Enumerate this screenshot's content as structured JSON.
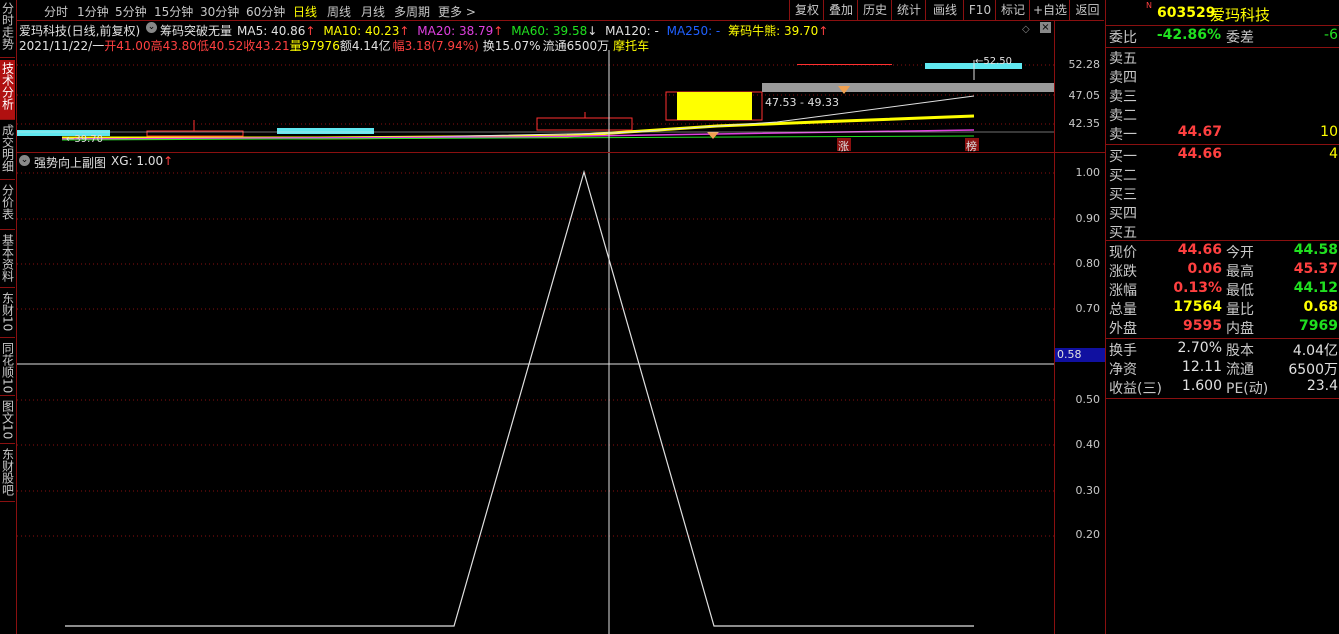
{
  "left_tabs": [
    {
      "label": "分时走势",
      "active": false
    },
    {
      "label": "技术分析",
      "active": true
    },
    {
      "label": "成交明细",
      "active": false
    },
    {
      "label": "分价表",
      "active": false
    },
    {
      "label": "基本资料",
      "active": false
    },
    {
      "label": "东财10",
      "active": false
    },
    {
      "label": "同花顺10",
      "active": false
    },
    {
      "label": "图文10",
      "active": false
    },
    {
      "label": "东财股吧",
      "active": false
    }
  ],
  "toolbar": {
    "periods": [
      "分时",
      "1分钟",
      "5分钟",
      "15分钟",
      "30分钟",
      "60分钟",
      "日线",
      "周线",
      "月线",
      "多周期",
      "更多 >"
    ],
    "selected": "日线",
    "right_buttons": [
      "复权",
      "叠加",
      "历史",
      "统计",
      "画线",
      "F10",
      "标记",
      "+自选",
      "返回"
    ]
  },
  "main_chart": {
    "title": "爱玛科技(日线,前复权)",
    "indicator_name": "筹码突破无量",
    "ma": [
      {
        "label": "MA5: 40.86",
        "arrow": "↑",
        "color": "#e0e0e0"
      },
      {
        "label": "MA10: 40.23",
        "arrow": "↑",
        "color": "#ffff00"
      },
      {
        "label": "MA20: 38.79",
        "arrow": "↑",
        "color": "#e040e0"
      },
      {
        "label": "MA60: 39.58",
        "arrow": "↓",
        "color": "#20e020"
      },
      {
        "label": "MA120: -",
        "arrow": "",
        "color": "#e0e0e0"
      },
      {
        "label": "MA250: -",
        "arrow": "",
        "color": "#2060ff"
      }
    ],
    "chip_label": "筹码牛熊: 39.70",
    "date": "2021/11/22/一",
    "open": "开41.00",
    "high": "高43.80",
    "low": "低40.52",
    "close": "收43.21",
    "volume": "量97976",
    "amount": "额4.14亿",
    "amplitude": "幅3.18(7.94%)",
    "turnover": "换15.07%",
    "float": "流通6500万",
    "concept": "摩托车",
    "price_ticks": [
      "52.28",
      "47.05",
      "42.35"
    ],
    "range_label": "47.53 - 49.33",
    "high_mark": "52.50",
    "low_mark": "39.70",
    "tag_zhang": "涨",
    "tag_bang": "榜"
  },
  "sub_chart": {
    "title": "强势向上副图",
    "xg_label": "XG: 1.00",
    "ticks": [
      "1.00",
      "0.90",
      "0.80",
      "0.70",
      "0.50",
      "0.40",
      "0.30",
      "0.20"
    ],
    "cursor_value": "0.58"
  },
  "quote": {
    "code": "603529",
    "name": "爱玛科技",
    "badge": "N",
    "weibi_label": "委比",
    "weibi": "-42.86%",
    "weicha_label": "委差",
    "weicha": "-6",
    "sells": [
      {
        "label": "卖五",
        "price": "",
        "vol": ""
      },
      {
        "label": "卖四",
        "price": "",
        "vol": ""
      },
      {
        "label": "卖三",
        "price": "",
        "vol": ""
      },
      {
        "label": "卖二",
        "price": "",
        "vol": ""
      },
      {
        "label": "卖一",
        "price": "44.67",
        "vol": "10"
      }
    ],
    "buys": [
      {
        "label": "买一",
        "price": "44.66",
        "vol": "4"
      },
      {
        "label": "买二",
        "price": "",
        "vol": ""
      },
      {
        "label": "买三",
        "price": "",
        "vol": ""
      },
      {
        "label": "买四",
        "price": "",
        "vol": ""
      },
      {
        "label": "买五",
        "price": "",
        "vol": ""
      }
    ],
    "stats": [
      {
        "l1": "现价",
        "v1": "44.66",
        "c1": "red",
        "l2": "今开",
        "v2": "44.58",
        "c2": "green"
      },
      {
        "l1": "涨跌",
        "v1": "0.06",
        "c1": "red",
        "l2": "最高",
        "v2": "45.37",
        "c2": "red"
      },
      {
        "l1": "涨幅",
        "v1": "0.13%",
        "c1": "red",
        "l2": "最低",
        "v2": "44.12",
        "c2": "green"
      },
      {
        "l1": "总量",
        "v1": "17564",
        "c1": "yellow",
        "l2": "量比",
        "v2": "0.68",
        "c2": "yellow"
      },
      {
        "l1": "外盘",
        "v1": "9595",
        "c1": "red",
        "l2": "内盘",
        "v2": "7969",
        "c2": "green"
      }
    ],
    "fund": [
      {
        "l1": "换手",
        "v1": "2.70%",
        "l2": "股本",
        "v2": "4.04亿"
      },
      {
        "l1": "净资",
        "v1": "12.11",
        "l2": "流通",
        "v2": "6500万"
      },
      {
        "l1": "收益(三)",
        "v1": "1.600",
        "l2": "PE(动)",
        "v2": "23.4"
      }
    ]
  },
  "colors": {
    "up": "#ff4040",
    "down": "#20e020",
    "frame": "#8a1010",
    "accent": "#ffff00"
  }
}
